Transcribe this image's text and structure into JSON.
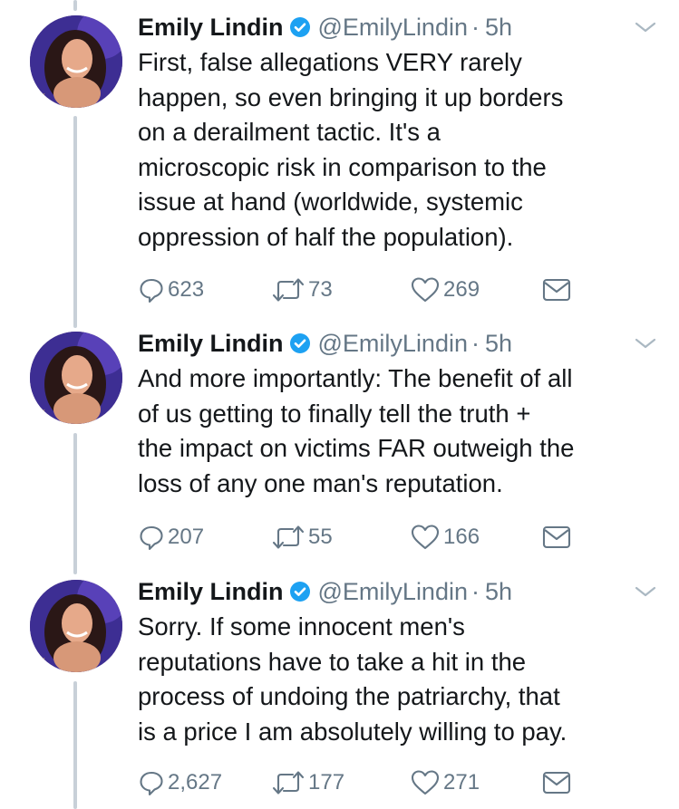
{
  "colors": {
    "text": "#14171a",
    "secondary": "#657786",
    "verified": "#1da1f2",
    "thread_line": "#c8d0d8"
  },
  "tweets": [
    {
      "name": "Emily Lindin",
      "handle": "@EmilyLindin",
      "separator": "·",
      "time": "5h",
      "text": "First, false allegations VERY rarely\nhappen, so even bringing it up borders\non a derailment tactic. It's a\nmicroscopic risk in comparison to the\nissue at hand (worldwide, systemic\noppression of half the population).",
      "replies": "623",
      "retweets": "73",
      "likes": "269"
    },
    {
      "name": "Emily Lindin",
      "handle": "@EmilyLindin",
      "separator": "·",
      "time": "5h",
      "text": "And more importantly: The benefit of all\nof us getting to finally tell the truth +\nthe impact on victims FAR outweigh the\nloss of any one man's reputation.",
      "replies": "207",
      "retweets": "55",
      "likes": "166"
    },
    {
      "name": "Emily Lindin",
      "handle": "@EmilyLindin",
      "separator": "·",
      "time": "5h",
      "text": "Sorry. If some innocent men's\nreputations have to take a hit in the\nprocess of undoing the patriarchy, that\nis a price I am absolutely willing to pay.",
      "replies": "2,627",
      "retweets": "177",
      "likes": "271"
    }
  ],
  "icons": {
    "avatar": "profile-photo",
    "verified": "verified-badge-icon",
    "caret": "chevron-down-icon",
    "reply": "reply-icon",
    "retweet": "retweet-icon",
    "like": "heart-icon",
    "dm": "envelope-icon"
  }
}
